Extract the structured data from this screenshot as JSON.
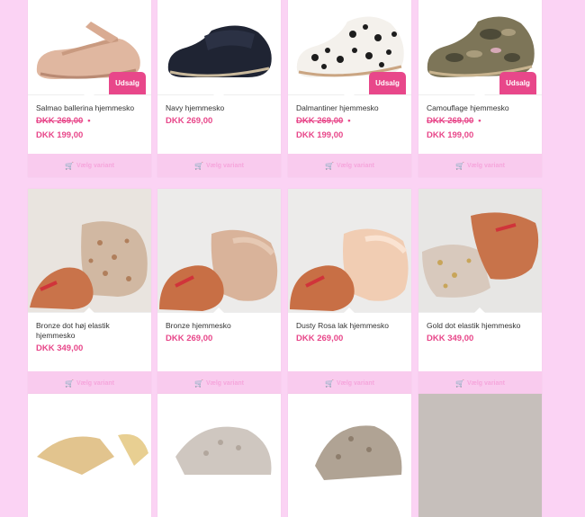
{
  "ui": {
    "variant_label": "Vælg variant",
    "cart_icon": "cart-icon",
    "sale_badge": "Udsalg"
  },
  "products": [
    {
      "name": "Salmao ballerina hjemmesko",
      "old_price": "DKK 269,00",
      "price": "DKK 199,00",
      "sale": true
    },
    {
      "name": "Navy hjemmesko",
      "old_price": "",
      "price": "DKK 269,00",
      "sale": false
    },
    {
      "name": "Dalmantiner hjemmesko",
      "old_price": "DKK 269,00",
      "price": "DKK 199,00",
      "sale": true
    },
    {
      "name": "Camouflage hjemmesko",
      "old_price": "DKK 269,00",
      "price": "DKK 199,00",
      "sale": true
    },
    {
      "name": "Bronze dot høj elastik hjemmesko",
      "old_price": "",
      "price": "DKK 349,00",
      "sale": false
    },
    {
      "name": "Bronze hjemmesko",
      "old_price": "",
      "price": "DKK 269,00",
      "sale": false
    },
    {
      "name": "Dusty Rosa lak hjemmesko",
      "old_price": "",
      "price": "DKK 269,00",
      "sale": false
    },
    {
      "name": "Gold dot elastik hjemmesko",
      "old_price": "",
      "price": "DKK 349,00",
      "sale": false
    }
  ],
  "colors": {
    "accent": "#e8478a",
    "background": "#fbd3f4",
    "variant_bg": "#f9cbee"
  }
}
